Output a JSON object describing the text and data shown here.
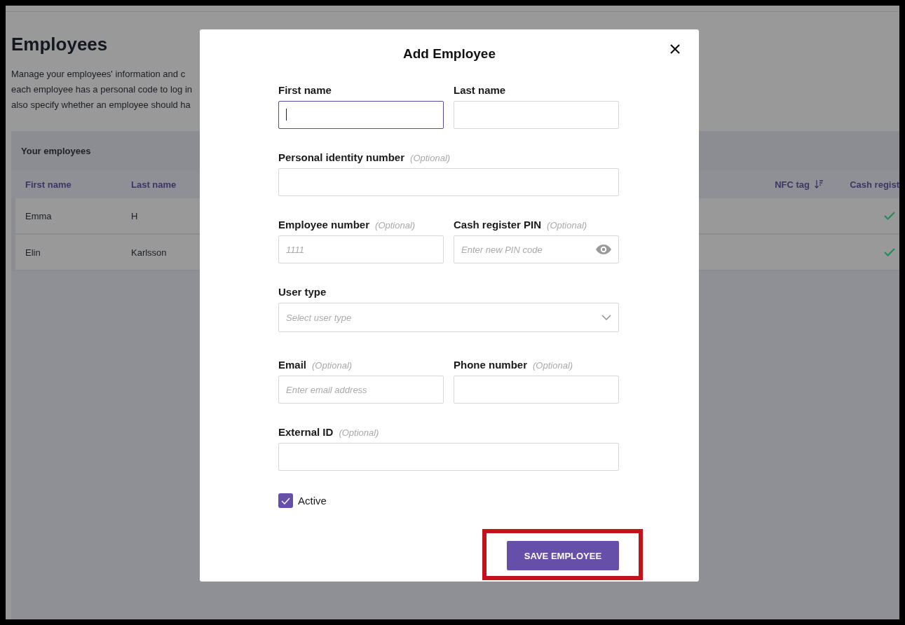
{
  "page": {
    "title": "Employees",
    "description_lines": [
      "Manage your employees' information and c",
      "each employee has a personal code to log in",
      "also specify whether an employee should ha"
    ],
    "table": {
      "title": "Your employees",
      "columns": [
        {
          "label": "First name",
          "sortable": false
        },
        {
          "label": "Last name",
          "sortable": false
        },
        {
          "label": "NFC tag",
          "sortable": true
        },
        {
          "label": "Cash regist",
          "sortable": false
        }
      ],
      "rows": [
        {
          "first_name": "Emma",
          "last_name": "H",
          "cash_register": true
        },
        {
          "first_name": "Elin",
          "last_name": "Karlsson",
          "cash_register": true
        }
      ]
    }
  },
  "dialog": {
    "title": "Add Employee",
    "rows": [
      {
        "fields": [
          {
            "label": "First name",
            "kind": "text",
            "focused": true
          },
          {
            "label": "Last name",
            "kind": "text",
            "focused": false
          }
        ]
      },
      {
        "fields": [
          {
            "label": "Personal identity number",
            "optional": "(Optional)",
            "kind": "text",
            "focused": false
          }
        ]
      },
      {
        "fields": [
          {
            "label": "Employee number",
            "optional": "(Optional)",
            "kind": "text",
            "placeholder": "1111",
            "focused": false
          },
          {
            "label": "Cash register PIN",
            "optional": "(Optional)",
            "kind": "password",
            "placeholder": "Enter new PIN code",
            "focused": false
          }
        ]
      },
      {
        "fields": [
          {
            "label": "User type",
            "kind": "select",
            "placeholder": "Select user type",
            "focused": false
          }
        ]
      },
      {
        "fields": [
          {
            "label": "Email",
            "optional": "(Optional)",
            "kind": "text",
            "placeholder": "Enter email address",
            "focused": false
          },
          {
            "label": "Phone number",
            "optional": "(Optional)",
            "kind": "text",
            "focused": false
          }
        ]
      },
      {
        "fields": [
          {
            "label": "External ID",
            "optional": "(Optional)",
            "kind": "text",
            "focused": false
          }
        ]
      }
    ],
    "checkbox": {
      "label": "Active",
      "checked": true
    },
    "button": {
      "label": "SAVE EMPLOYEE",
      "highlighted": true
    }
  }
}
